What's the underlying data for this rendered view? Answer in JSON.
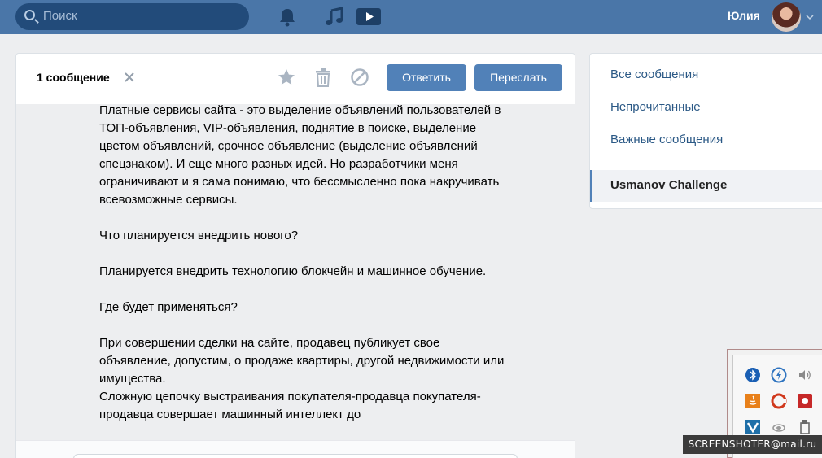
{
  "header": {
    "search_placeholder": "Поиск",
    "user_name": "Юлия",
    "accent_color": "#4a76a8"
  },
  "panel": {
    "message_count": "1 сообщение",
    "reply_label": "Ответить",
    "forward_label": "Переслать",
    "message_text": "Платные сервисы сайта - это выделение объявлений пользователей в ТОП-объявления, VIP-объявления, поднятие в поиске, выделение цветом объявлений, срочное объявление (выделение объявлений спецзнаком). И еще много разных идей. Но разработчики меня ограничивают и я сама понимаю, что бессмысленно пока накручивать всевозможные сервисы.\n\nЧто планируется внедрить нового?\n\nПланируется внедрить технологию блокчейн и машинное обучение.\n\nГде будет применяться?\n\nПри совершении сделки на сайте, продавец публикует свое объявление, допустим, о продаже квартиры, другой недвижимости или имущества.\nСложную цепочку выстраивания покупателя-продавца покупателя-продавца совершает машинный интеллект до"
  },
  "sidebar": {
    "items": [
      {
        "label": "Все сообщения"
      },
      {
        "label": "Непрочитанные"
      },
      {
        "label": "Важные сообщения"
      }
    ],
    "active_chat": "Usmanov Challenge"
  },
  "watermark": "SCREENSHOTER@mail.ru"
}
